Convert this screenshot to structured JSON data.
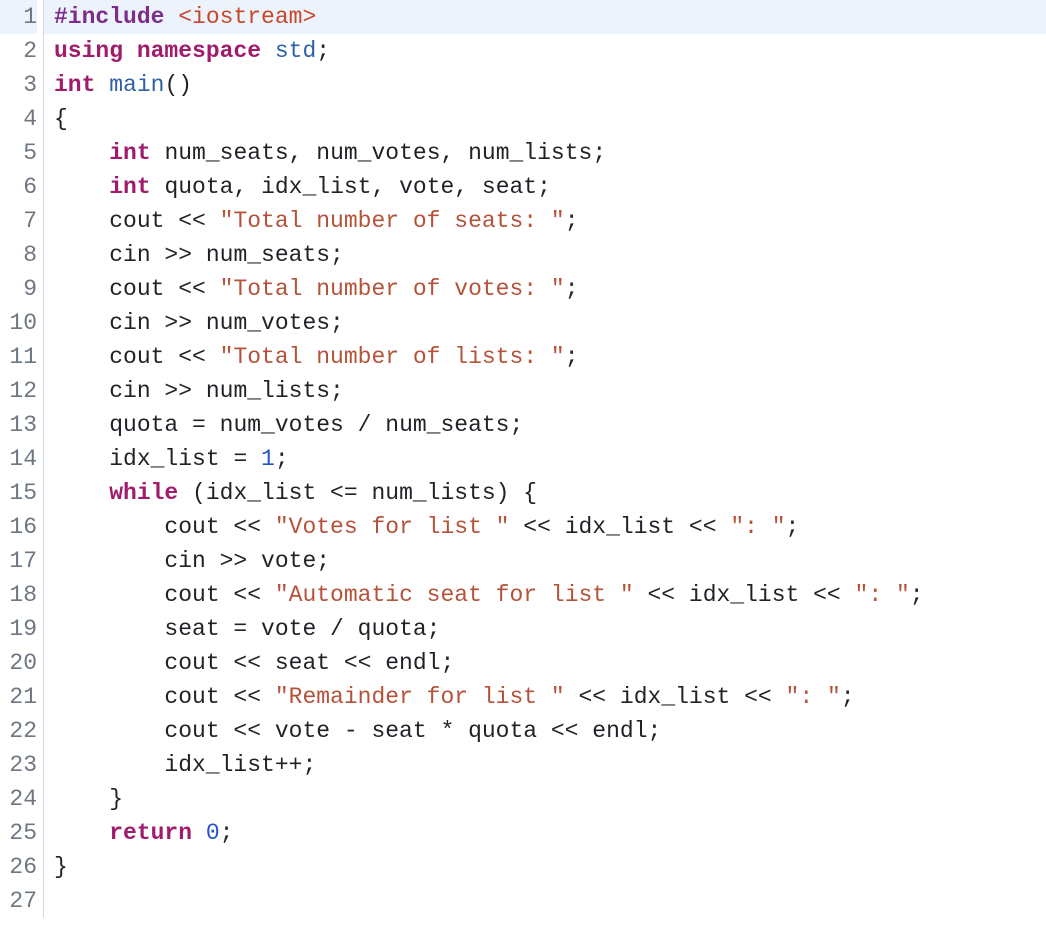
{
  "highlighted_line": 1,
  "lines": [
    {
      "n": 1,
      "tokens": [
        {
          "c": "tk-macro",
          "t": "#include"
        },
        {
          "c": "tk-punct",
          "t": " "
        },
        {
          "c": "tk-include",
          "t": "<iostream>"
        }
      ]
    },
    {
      "n": 2,
      "tokens": [
        {
          "c": "tk-kw",
          "t": "using"
        },
        {
          "c": "tk-punct",
          "t": " "
        },
        {
          "c": "tk-ns",
          "t": "namespace"
        },
        {
          "c": "tk-punct",
          "t": " "
        },
        {
          "c": "tk-func",
          "t": "std"
        },
        {
          "c": "tk-punct",
          "t": ";"
        }
      ]
    },
    {
      "n": 3,
      "tokens": [
        {
          "c": "tk-type",
          "t": "int"
        },
        {
          "c": "tk-punct",
          "t": " "
        },
        {
          "c": "tk-func",
          "t": "main"
        },
        {
          "c": "tk-punct",
          "t": "()"
        }
      ]
    },
    {
      "n": 4,
      "tokens": [
        {
          "c": "tk-punct",
          "t": "{"
        }
      ]
    },
    {
      "n": 5,
      "tokens": [
        {
          "c": "tk-punct",
          "t": "    "
        },
        {
          "c": "tk-type",
          "t": "int"
        },
        {
          "c": "tk-punct",
          "t": " "
        },
        {
          "c": "tk-ident",
          "t": "num_seats, num_votes, num_lists;"
        }
      ]
    },
    {
      "n": 6,
      "tokens": [
        {
          "c": "tk-punct",
          "t": "    "
        },
        {
          "c": "tk-type",
          "t": "int"
        },
        {
          "c": "tk-punct",
          "t": " "
        },
        {
          "c": "tk-ident",
          "t": "quota, idx_list, vote, seat;"
        }
      ]
    },
    {
      "n": 7,
      "tokens": [
        {
          "c": "tk-punct",
          "t": "    "
        },
        {
          "c": "tk-ident",
          "t": "cout << "
        },
        {
          "c": "tk-str",
          "t": "\"Total number of seats: \""
        },
        {
          "c": "tk-punct",
          "t": ";"
        }
      ]
    },
    {
      "n": 8,
      "tokens": [
        {
          "c": "tk-punct",
          "t": "    "
        },
        {
          "c": "tk-ident",
          "t": "cin >> num_seats;"
        }
      ]
    },
    {
      "n": 9,
      "tokens": [
        {
          "c": "tk-punct",
          "t": "    "
        },
        {
          "c": "tk-ident",
          "t": "cout << "
        },
        {
          "c": "tk-str",
          "t": "\"Total number of votes: \""
        },
        {
          "c": "tk-punct",
          "t": ";"
        }
      ]
    },
    {
      "n": 10,
      "tokens": [
        {
          "c": "tk-punct",
          "t": "    "
        },
        {
          "c": "tk-ident",
          "t": "cin >> num_votes;"
        }
      ]
    },
    {
      "n": 11,
      "tokens": [
        {
          "c": "tk-punct",
          "t": "    "
        },
        {
          "c": "tk-ident",
          "t": "cout << "
        },
        {
          "c": "tk-str",
          "t": "\"Total number of lists: \""
        },
        {
          "c": "tk-punct",
          "t": ";"
        }
      ]
    },
    {
      "n": 12,
      "tokens": [
        {
          "c": "tk-punct",
          "t": "    "
        },
        {
          "c": "tk-ident",
          "t": "cin >> num_lists;"
        }
      ]
    },
    {
      "n": 13,
      "tokens": [
        {
          "c": "tk-punct",
          "t": "    "
        },
        {
          "c": "tk-ident",
          "t": "quota = num_votes / num_seats;"
        }
      ]
    },
    {
      "n": 14,
      "tokens": [
        {
          "c": "tk-punct",
          "t": "    "
        },
        {
          "c": "tk-ident",
          "t": "idx_list = "
        },
        {
          "c": "tk-num",
          "t": "1"
        },
        {
          "c": "tk-punct",
          "t": ";"
        }
      ]
    },
    {
      "n": 15,
      "tokens": [
        {
          "c": "tk-punct",
          "t": "    "
        },
        {
          "c": "tk-kw",
          "t": "while"
        },
        {
          "c": "tk-ident",
          "t": " (idx_list <= num_lists) {"
        }
      ]
    },
    {
      "n": 16,
      "tokens": [
        {
          "c": "tk-punct",
          "t": "        "
        },
        {
          "c": "tk-ident",
          "t": "cout << "
        },
        {
          "c": "tk-str",
          "t": "\"Votes for list \""
        },
        {
          "c": "tk-ident",
          "t": " << idx_list << "
        },
        {
          "c": "tk-str",
          "t": "\": \""
        },
        {
          "c": "tk-punct",
          "t": ";"
        }
      ]
    },
    {
      "n": 17,
      "tokens": [
        {
          "c": "tk-punct",
          "t": "        "
        },
        {
          "c": "tk-ident",
          "t": "cin >> vote;"
        }
      ]
    },
    {
      "n": 18,
      "tokens": [
        {
          "c": "tk-punct",
          "t": "        "
        },
        {
          "c": "tk-ident",
          "t": "cout << "
        },
        {
          "c": "tk-str",
          "t": "\"Automatic seat for list \""
        },
        {
          "c": "tk-ident",
          "t": " << idx_list << "
        },
        {
          "c": "tk-str",
          "t": "\": \""
        },
        {
          "c": "tk-punct",
          "t": ";"
        }
      ]
    },
    {
      "n": 19,
      "tokens": [
        {
          "c": "tk-punct",
          "t": "        "
        },
        {
          "c": "tk-ident",
          "t": "seat = vote / quota;"
        }
      ]
    },
    {
      "n": 20,
      "tokens": [
        {
          "c": "tk-punct",
          "t": "        "
        },
        {
          "c": "tk-ident",
          "t": "cout << seat << endl;"
        }
      ]
    },
    {
      "n": 21,
      "tokens": [
        {
          "c": "tk-punct",
          "t": "        "
        },
        {
          "c": "tk-ident",
          "t": "cout << "
        },
        {
          "c": "tk-str",
          "t": "\"Remainder for list \""
        },
        {
          "c": "tk-ident",
          "t": " << idx_list << "
        },
        {
          "c": "tk-str",
          "t": "\": \""
        },
        {
          "c": "tk-punct",
          "t": ";"
        }
      ]
    },
    {
      "n": 22,
      "tokens": [
        {
          "c": "tk-punct",
          "t": "        "
        },
        {
          "c": "tk-ident",
          "t": "cout << vote - seat * quota << endl;"
        }
      ]
    },
    {
      "n": 23,
      "tokens": [
        {
          "c": "tk-punct",
          "t": "        "
        },
        {
          "c": "tk-ident",
          "t": "idx_list++;"
        }
      ]
    },
    {
      "n": 24,
      "tokens": [
        {
          "c": "tk-punct",
          "t": "    }"
        }
      ]
    },
    {
      "n": 25,
      "tokens": [
        {
          "c": "tk-punct",
          "t": "    "
        },
        {
          "c": "tk-kw",
          "t": "return"
        },
        {
          "c": "tk-punct",
          "t": " "
        },
        {
          "c": "tk-num",
          "t": "0"
        },
        {
          "c": "tk-punct",
          "t": ";"
        }
      ]
    },
    {
      "n": 26,
      "tokens": [
        {
          "c": "tk-punct",
          "t": "}"
        }
      ]
    },
    {
      "n": 27,
      "tokens": [
        {
          "c": "tk-punct",
          "t": ""
        }
      ]
    }
  ]
}
